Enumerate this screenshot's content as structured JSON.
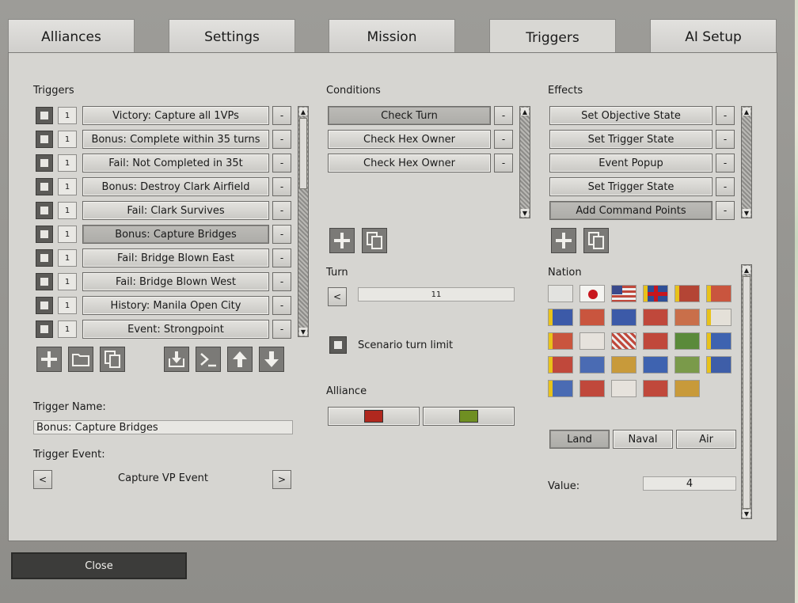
{
  "tabs": [
    {
      "label": "Alliances",
      "active": false
    },
    {
      "label": "Settings",
      "active": false
    },
    {
      "label": "Mission",
      "active": false
    },
    {
      "label": "Triggers",
      "active": true
    },
    {
      "label": "AI Setup",
      "active": false
    }
  ],
  "triggers": {
    "heading": "Triggers",
    "items": [
      {
        "count": "1",
        "label": "Victory: Capture all 1VPs",
        "remove": "-"
      },
      {
        "count": "1",
        "label": "Bonus: Complete within 35 turns",
        "remove": "-"
      },
      {
        "count": "1",
        "label": "Fail: Not Completed in 35t",
        "remove": "-"
      },
      {
        "count": "1",
        "label": "Bonus: Destroy Clark Airfield",
        "remove": "-"
      },
      {
        "count": "1",
        "label": "Fail: Clark Survives",
        "remove": "-"
      },
      {
        "count": "1",
        "label": "Bonus: Capture Bridges",
        "remove": "-",
        "selected": true
      },
      {
        "count": "1",
        "label": "Fail: Bridge Blown East",
        "remove": "-"
      },
      {
        "count": "1",
        "label": "Fail: Bridge Blown West",
        "remove": "-"
      },
      {
        "count": "1",
        "label": "History: Manila Open City",
        "remove": "-"
      },
      {
        "count": "1",
        "label": "Event: Strongpoint",
        "remove": "-"
      }
    ],
    "toolbar_icons": [
      "add-icon",
      "folder-icon",
      "copy-icon",
      "import-icon",
      "console-icon",
      "arrow-up-icon",
      "arrow-down-icon"
    ]
  },
  "trigger_name": {
    "label": "Trigger Name:",
    "value": "Bonus: Capture Bridges"
  },
  "trigger_event": {
    "label": "Trigger Event:",
    "value": "Capture VP Event",
    "prev": "<",
    "next": ">"
  },
  "conditions": {
    "heading": "Conditions",
    "items": [
      {
        "label": "Check Turn",
        "remove": "-",
        "selected": true
      },
      {
        "label": "Check Hex Owner",
        "remove": "-"
      },
      {
        "label": "Check Hex Owner",
        "remove": "-"
      }
    ]
  },
  "turn": {
    "label": "Turn",
    "value": "11",
    "prev": "<",
    "limit_label": "Scenario turn limit"
  },
  "alliance": {
    "label": "Alliance",
    "colors": [
      "#b0281e",
      "#6f8f22"
    ]
  },
  "effects": {
    "heading": "Effects",
    "items": [
      {
        "label": "Set Objective State",
        "remove": "-"
      },
      {
        "label": "Set Trigger State",
        "remove": "-"
      },
      {
        "label": "Event Popup",
        "remove": "-"
      },
      {
        "label": "Set Trigger State",
        "remove": "-"
      },
      {
        "label": "Add Command Points",
        "remove": "-",
        "selected": true
      }
    ]
  },
  "nation": {
    "label": "Nation",
    "flag_count": 29
  },
  "unit_types": [
    {
      "label": "Land",
      "selected": true
    },
    {
      "label": "Naval"
    },
    {
      "label": "Air"
    }
  ],
  "value": {
    "label": "Value:",
    "value": "4"
  },
  "close_label": "Close"
}
